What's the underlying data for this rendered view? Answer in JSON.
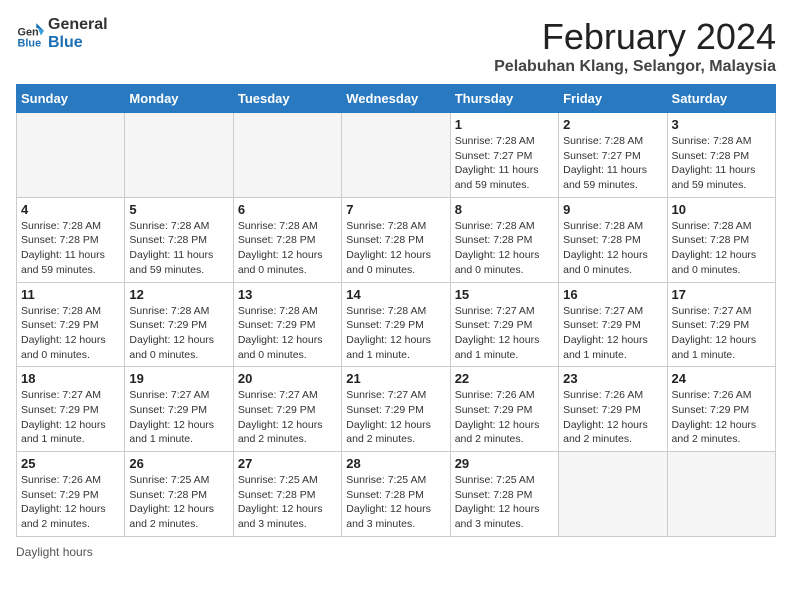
{
  "header": {
    "logo_general": "General",
    "logo_blue": "Blue",
    "title": "February 2024",
    "subtitle": "Pelabuhan Klang, Selangor, Malaysia"
  },
  "calendar": {
    "days_of_week": [
      "Sunday",
      "Monday",
      "Tuesday",
      "Wednesday",
      "Thursday",
      "Friday",
      "Saturday"
    ],
    "weeks": [
      [
        {
          "day": "",
          "info": ""
        },
        {
          "day": "",
          "info": ""
        },
        {
          "day": "",
          "info": ""
        },
        {
          "day": "",
          "info": ""
        },
        {
          "day": "1",
          "info": "Sunrise: 7:28 AM\nSunset: 7:27 PM\nDaylight: 11 hours and 59 minutes."
        },
        {
          "day": "2",
          "info": "Sunrise: 7:28 AM\nSunset: 7:27 PM\nDaylight: 11 hours and 59 minutes."
        },
        {
          "day": "3",
          "info": "Sunrise: 7:28 AM\nSunset: 7:28 PM\nDaylight: 11 hours and 59 minutes."
        }
      ],
      [
        {
          "day": "4",
          "info": "Sunrise: 7:28 AM\nSunset: 7:28 PM\nDaylight: 11 hours and 59 minutes."
        },
        {
          "day": "5",
          "info": "Sunrise: 7:28 AM\nSunset: 7:28 PM\nDaylight: 11 hours and 59 minutes."
        },
        {
          "day": "6",
          "info": "Sunrise: 7:28 AM\nSunset: 7:28 PM\nDaylight: 12 hours and 0 minutes."
        },
        {
          "day": "7",
          "info": "Sunrise: 7:28 AM\nSunset: 7:28 PM\nDaylight: 12 hours and 0 minutes."
        },
        {
          "day": "8",
          "info": "Sunrise: 7:28 AM\nSunset: 7:28 PM\nDaylight: 12 hours and 0 minutes."
        },
        {
          "day": "9",
          "info": "Sunrise: 7:28 AM\nSunset: 7:28 PM\nDaylight: 12 hours and 0 minutes."
        },
        {
          "day": "10",
          "info": "Sunrise: 7:28 AM\nSunset: 7:28 PM\nDaylight: 12 hours and 0 minutes."
        }
      ],
      [
        {
          "day": "11",
          "info": "Sunrise: 7:28 AM\nSunset: 7:29 PM\nDaylight: 12 hours and 0 minutes."
        },
        {
          "day": "12",
          "info": "Sunrise: 7:28 AM\nSunset: 7:29 PM\nDaylight: 12 hours and 0 minutes."
        },
        {
          "day": "13",
          "info": "Sunrise: 7:28 AM\nSunset: 7:29 PM\nDaylight: 12 hours and 0 minutes."
        },
        {
          "day": "14",
          "info": "Sunrise: 7:28 AM\nSunset: 7:29 PM\nDaylight: 12 hours and 1 minute."
        },
        {
          "day": "15",
          "info": "Sunrise: 7:27 AM\nSunset: 7:29 PM\nDaylight: 12 hours and 1 minute."
        },
        {
          "day": "16",
          "info": "Sunrise: 7:27 AM\nSunset: 7:29 PM\nDaylight: 12 hours and 1 minute."
        },
        {
          "day": "17",
          "info": "Sunrise: 7:27 AM\nSunset: 7:29 PM\nDaylight: 12 hours and 1 minute."
        }
      ],
      [
        {
          "day": "18",
          "info": "Sunrise: 7:27 AM\nSunset: 7:29 PM\nDaylight: 12 hours and 1 minute."
        },
        {
          "day": "19",
          "info": "Sunrise: 7:27 AM\nSunset: 7:29 PM\nDaylight: 12 hours and 1 minute."
        },
        {
          "day": "20",
          "info": "Sunrise: 7:27 AM\nSunset: 7:29 PM\nDaylight: 12 hours and 2 minutes."
        },
        {
          "day": "21",
          "info": "Sunrise: 7:27 AM\nSunset: 7:29 PM\nDaylight: 12 hours and 2 minutes."
        },
        {
          "day": "22",
          "info": "Sunrise: 7:26 AM\nSunset: 7:29 PM\nDaylight: 12 hours and 2 minutes."
        },
        {
          "day": "23",
          "info": "Sunrise: 7:26 AM\nSunset: 7:29 PM\nDaylight: 12 hours and 2 minutes."
        },
        {
          "day": "24",
          "info": "Sunrise: 7:26 AM\nSunset: 7:29 PM\nDaylight: 12 hours and 2 minutes."
        }
      ],
      [
        {
          "day": "25",
          "info": "Sunrise: 7:26 AM\nSunset: 7:29 PM\nDaylight: 12 hours and 2 minutes."
        },
        {
          "day": "26",
          "info": "Sunrise: 7:25 AM\nSunset: 7:28 PM\nDaylight: 12 hours and 2 minutes."
        },
        {
          "day": "27",
          "info": "Sunrise: 7:25 AM\nSunset: 7:28 PM\nDaylight: 12 hours and 3 minutes."
        },
        {
          "day": "28",
          "info": "Sunrise: 7:25 AM\nSunset: 7:28 PM\nDaylight: 12 hours and 3 minutes."
        },
        {
          "day": "29",
          "info": "Sunrise: 7:25 AM\nSunset: 7:28 PM\nDaylight: 12 hours and 3 minutes."
        },
        {
          "day": "",
          "info": ""
        },
        {
          "day": "",
          "info": ""
        }
      ]
    ]
  },
  "footer": {
    "note": "Daylight hours"
  }
}
